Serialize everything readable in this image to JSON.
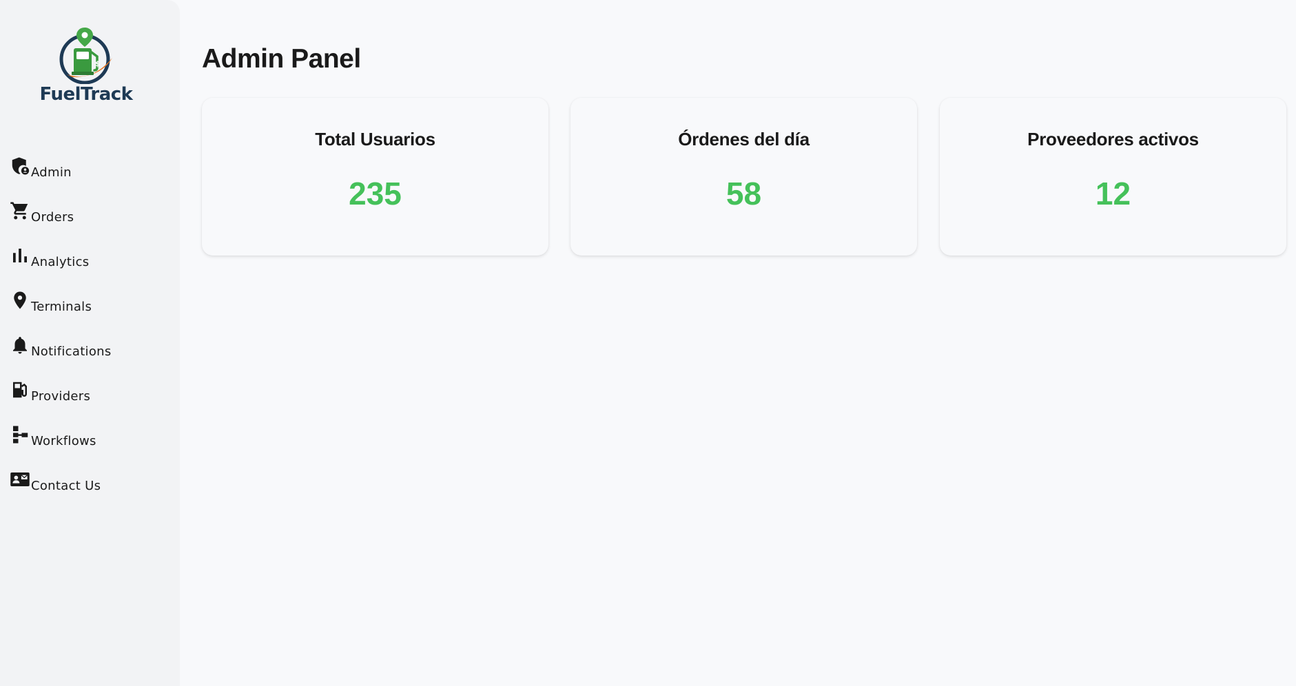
{
  "brand": {
    "name": "FuelTrack"
  },
  "sidebar": {
    "items": [
      {
        "label": "Admin",
        "icon": "admin-shield-icon"
      },
      {
        "label": "Orders",
        "icon": "cart-icon"
      },
      {
        "label": "Analytics",
        "icon": "bar-chart-icon"
      },
      {
        "label": "Terminals",
        "icon": "location-pin-icon"
      },
      {
        "label": "Notifications",
        "icon": "bell-icon"
      },
      {
        "label": "Providers",
        "icon": "fuel-pump-icon"
      },
      {
        "label": "Workflows",
        "icon": "workflow-icon"
      },
      {
        "label": "Contact Us",
        "icon": "contact-card-icon"
      }
    ]
  },
  "main": {
    "title": "Admin Panel",
    "cards": [
      {
        "title": "Total Usuarios",
        "value": "235"
      },
      {
        "title": "Órdenes del día",
        "value": "58"
      },
      {
        "title": "Proveedores activos",
        "value": "12"
      }
    ]
  },
  "colors": {
    "accent_green": "#45c15a",
    "brand_navy": "#1e3a55",
    "brand_orange": "#e87722",
    "sidebar_bg": "#f2f3f5",
    "page_bg": "#f8f9fb"
  }
}
